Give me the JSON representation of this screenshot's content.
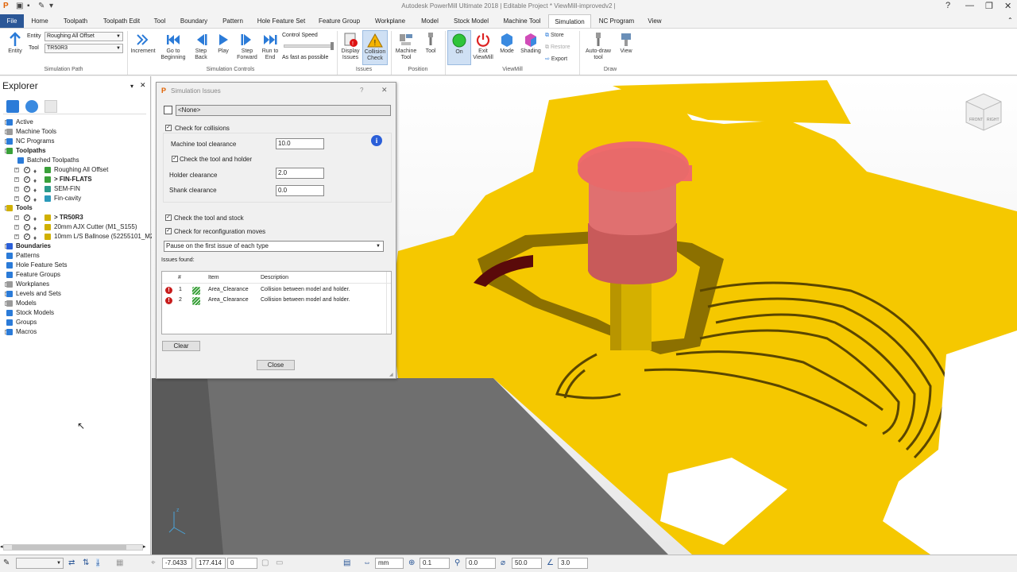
{
  "window": {
    "title": "Autodesk PowerMill Ultimate 2018   |  Editable Project * ViewMill-improvedv2 |"
  },
  "tabs": [
    "File",
    "Home",
    "Toolpath",
    "Toolpath Edit",
    "Tool",
    "Boundary",
    "Pattern",
    "Hole Feature Set",
    "Feature Group",
    "Workplane",
    "Model",
    "Stock Model",
    "Machine Tool",
    "Simulation",
    "NC Program",
    "View"
  ],
  "ribbon": {
    "entity_label": "Entity",
    "entity_value": "Roughing All Offset",
    "tool_label": "Tool",
    "tool_value": "TR50R3",
    "entity_btn": "Entity",
    "group_sim_path": "Simulation Path",
    "increment": "Increment",
    "go_to_beginning": "Go to Beginning",
    "step_back": "Step Back",
    "play": "Play",
    "step_forward": "Step Forward",
    "run_to_end": "Run to End",
    "control_speed": "Control Speed",
    "as_fast_as_possible": "As fast as possible",
    "group_sim_controls": "Simulation Controls",
    "display_issues": "Display Issues",
    "collision_check": "Collision Check",
    "group_issues": "Issues",
    "machine_tool": "Machine Tool",
    "tool": "Tool",
    "group_position": "Position",
    "on": "On",
    "exit_viewmill": "Exit ViewMill",
    "mode": "Mode",
    "shading": "Shading",
    "store": "Store",
    "restore": "Restore",
    "export": "Export",
    "group_viewmill": "ViewMill",
    "auto_draw_tool": "Auto-draw tool",
    "view": "View",
    "group_draw": "Draw"
  },
  "explorer": {
    "title": "Explorer",
    "items": [
      {
        "label": "Active",
        "bold": false
      },
      {
        "label": "Machine Tools",
        "bold": false
      },
      {
        "label": "NC Programs",
        "bold": false
      },
      {
        "label": "Toolpaths",
        "bold": true
      },
      {
        "label": "Batched Toolpaths",
        "bold": false
      },
      {
        "label": "Roughing All Offset",
        "bold": false
      },
      {
        "label": "> FIN-FLATS",
        "bold": true
      },
      {
        "label": "SEM-FIN",
        "bold": false
      },
      {
        "label": "Fin-cavity",
        "bold": false
      },
      {
        "label": "Tools",
        "bold": true
      },
      {
        "label": "> TR50R3",
        "bold": true
      },
      {
        "label": "20mm AJX Cutter (M1_S155)",
        "bold": false
      },
      {
        "label": "10mm L/S Ballnose (52255101_M2_",
        "bold": false
      },
      {
        "label": "Boundaries",
        "bold": true
      },
      {
        "label": "Patterns",
        "bold": false
      },
      {
        "label": "Hole Feature Sets",
        "bold": false
      },
      {
        "label": "Feature Groups",
        "bold": false
      },
      {
        "label": "Workplanes",
        "bold": false
      },
      {
        "label": "Levels and Sets",
        "bold": false
      },
      {
        "label": "Models",
        "bold": false
      },
      {
        "label": "Stock Models",
        "bold": false
      },
      {
        "label": "Groups",
        "bold": false
      },
      {
        "label": "Macros",
        "bold": false
      }
    ]
  },
  "dialog": {
    "title": "Simulation Issues",
    "help": "?",
    "close_x": "✕",
    "selector": "<None>",
    "check_collisions": "Check for collisions",
    "machine_tool_clearance_label": "Machine tool clearance",
    "machine_tool_clearance": "10.0",
    "check_tool_holder": "Check the tool and holder",
    "holder_clearance_label": "Holder clearance",
    "holder_clearance": "2.0",
    "shank_clearance_label": "Shank clearance",
    "shank_clearance": "0.0",
    "check_tool_stock": "Check the tool and stock",
    "check_reconfig": "Check for reconfiguration moves",
    "pause_option": "Pause on the first issue of each type",
    "issues_found": "Issues found:",
    "columns": [
      "#",
      "Item",
      "Description"
    ],
    "issues": [
      {
        "num": "1",
        "item": "Area_Clearance",
        "desc": "Collision between model and holder."
      },
      {
        "num": "2",
        "item": "Area_Clearance",
        "desc": "Collision between model and holder."
      }
    ],
    "clear": "Clear",
    "close": "Close"
  },
  "statusbar": {
    "x": "-7.0433",
    "y": "177.414",
    "z": "0",
    "units": "mm",
    "tol1": "0.1",
    "tol2": "0.0",
    "diameter": "50.0",
    "angle": "3.0"
  },
  "viewcube": {
    "front": "FRONT",
    "right": "RIGHT"
  },
  "colors": {
    "accent": "#2b5797",
    "stock": "#f5c800",
    "holder": "#e87070",
    "tool_shank": "#d4b000"
  }
}
